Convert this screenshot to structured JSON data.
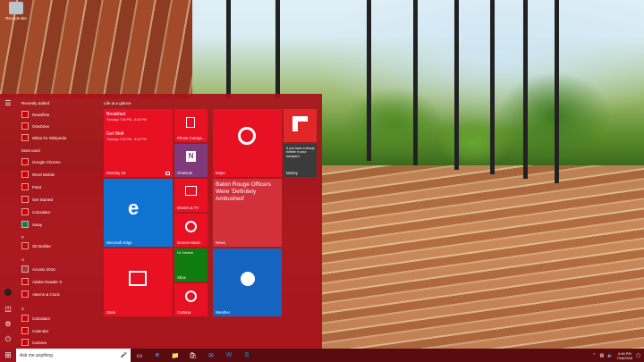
{
  "desktop": {
    "icon_label": "Recycle Bin"
  },
  "start_menu": {
    "recently_added_label": "Recently added",
    "recently_added": [
      "Newsflow",
      "OneDrive",
      "Wikia for Wikipedia"
    ],
    "most_used_label": "Most used",
    "most_used": [
      "Google Chrome",
      "Word Mobile",
      "Paint",
      "Get Started",
      "Calculator",
      "Sway"
    ],
    "hash_label": "#",
    "hash_apps": [
      "3D Builder"
    ],
    "a_label": "A",
    "a_apps": [
      "Access 2016",
      "Adobe Reader X",
      "Alarms & Clock"
    ],
    "c_label": "C",
    "c_apps": [
      "Calculator",
      "Calendar",
      "Camera"
    ],
    "tiles_group_label": "Life at a glance",
    "calendar": {
      "event1_title": "Breakfast",
      "event1_time": "Tuesday 7:00 PM - 8:00 PM",
      "event2_title": "Get Well",
      "event2_time": "Tuesday 7:00 PM - 8:00 PM",
      "day": "Monday 18"
    },
    "tiles": {
      "phone": "Phone Compa...",
      "onenote": "OneNote",
      "maps": "Maps",
      "flipboard_text": "If you have a trendy bobble in your backyard",
      "flipboard_source": "Money",
      "edge": "Microsoft Edge",
      "movies": "Movies & TV",
      "groove": "Groove Music",
      "news_headline": "Baton Rouge Officers Were 'Definitely Ambushed'",
      "news": "News",
      "store": "Store",
      "xbox_user": "HL Harlem",
      "xbox": "Xbox",
      "cortana": "Cortana",
      "weather": "Weather"
    }
  },
  "taskbar": {
    "search_placeholder": "Ask me anything",
    "time": "4:46 PM",
    "date": "7/18/2016"
  }
}
